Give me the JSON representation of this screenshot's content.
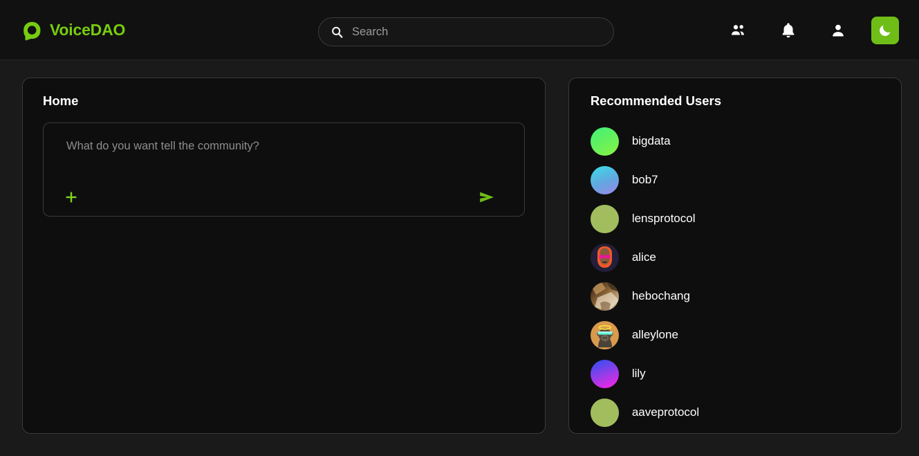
{
  "header": {
    "brand_name": "VoiceDAO",
    "brand_icon": "voicedao-logo-icon",
    "search": {
      "placeholder": "Search",
      "value": "",
      "icon": "search-icon"
    },
    "actions": [
      {
        "name": "people-icon",
        "label": "People"
      },
      {
        "name": "bell-icon",
        "label": "Notifications"
      },
      {
        "name": "person-icon",
        "label": "Profile"
      }
    ],
    "theme_toggle": {
      "icon": "moon-icon",
      "label": "Dark mode",
      "color": "#6fbe18"
    }
  },
  "feed": {
    "title": "Home",
    "composer": {
      "placeholder": "What do you want tell the community?",
      "value": "",
      "add_icon": "plus-icon",
      "send_icon": "send-icon"
    }
  },
  "sidebar": {
    "title": "Recommended Users",
    "users": [
      {
        "name": "bigdata",
        "avatar": "gradient-green"
      },
      {
        "name": "bob7",
        "avatar": "gradient-cyan-blue"
      },
      {
        "name": "lensprotocol",
        "avatar": "solid-olive"
      },
      {
        "name": "alice",
        "avatar": "pixel-character"
      },
      {
        "name": "hebochang",
        "avatar": "cat-photo"
      },
      {
        "name": "alleylone",
        "avatar": "ape-nft"
      },
      {
        "name": "lily",
        "avatar": "gradient-blue-magenta"
      },
      {
        "name": "aaveprotocol",
        "avatar": "solid-olive"
      }
    ]
  },
  "colors": {
    "accent_green": "#77cc11",
    "page_bg": "#1a1a1a",
    "card_bg": "#0e0e0e",
    "card_border": "#3a3a3a",
    "header_bg": "#111111"
  }
}
